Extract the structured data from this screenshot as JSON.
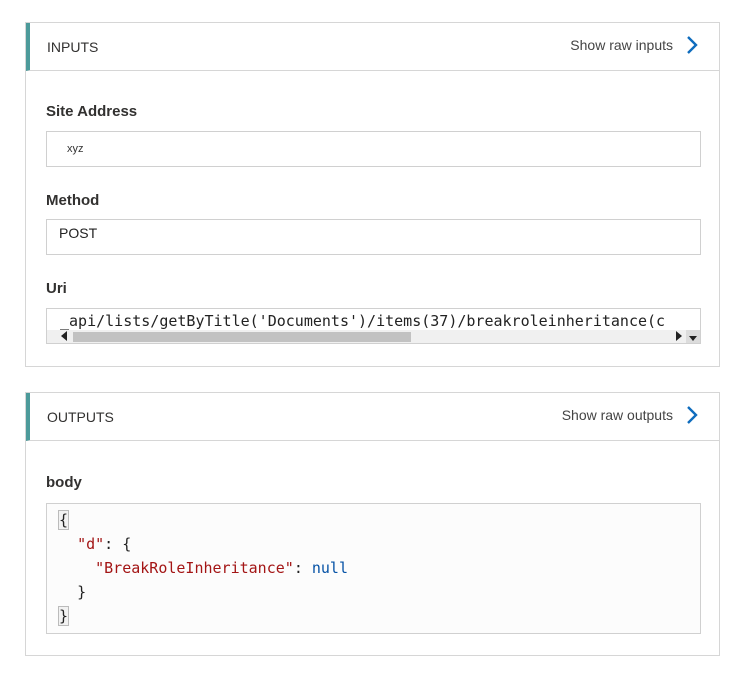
{
  "inputs": {
    "title": "INPUTS",
    "show_raw_label": "Show raw inputs",
    "site_address": {
      "label": "Site Address",
      "value": "xyz"
    },
    "method": {
      "label": "Method",
      "value": "POST"
    },
    "uri": {
      "label": "Uri",
      "value": "_api/lists/getByTitle('Documents')/items(37)/breakroleinheritance(c"
    }
  },
  "outputs": {
    "title": "OUTPUTS",
    "show_raw_label": "Show raw outputs",
    "body": {
      "label": "body",
      "open_brace": "{",
      "d_key": "\"d\"",
      "d_sep": ": {",
      "inner_key": "\"BreakRoleInheritance\"",
      "inner_sep": ": ",
      "inner_value": "null",
      "inner_close": "}",
      "close_brace": "}"
    }
  },
  "colors": {
    "accent_bar": "#4c9a9a",
    "link_chevron": "#0f6cbd",
    "json_key": "#a31515",
    "json_null": "#0451a5"
  }
}
